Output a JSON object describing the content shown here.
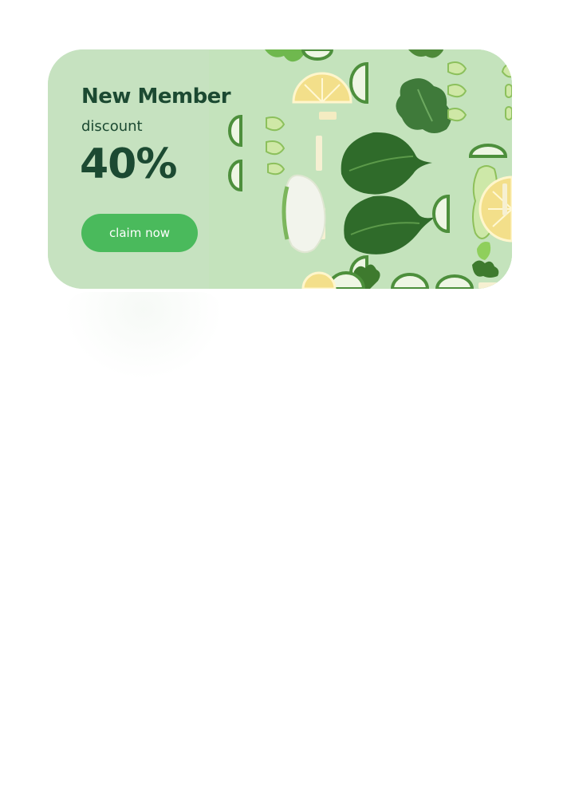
{
  "promo": {
    "title": "New Member",
    "subtitle": "discount",
    "percent": "40%",
    "cta_label": "claim now"
  },
  "image": {
    "subject": "flat-lay-vegetables-icon"
  },
  "colors": {
    "card_background": "#c6e2c0",
    "text": "#1c4a32",
    "button": "#4aba5c",
    "button_text": "#ffffff"
  }
}
